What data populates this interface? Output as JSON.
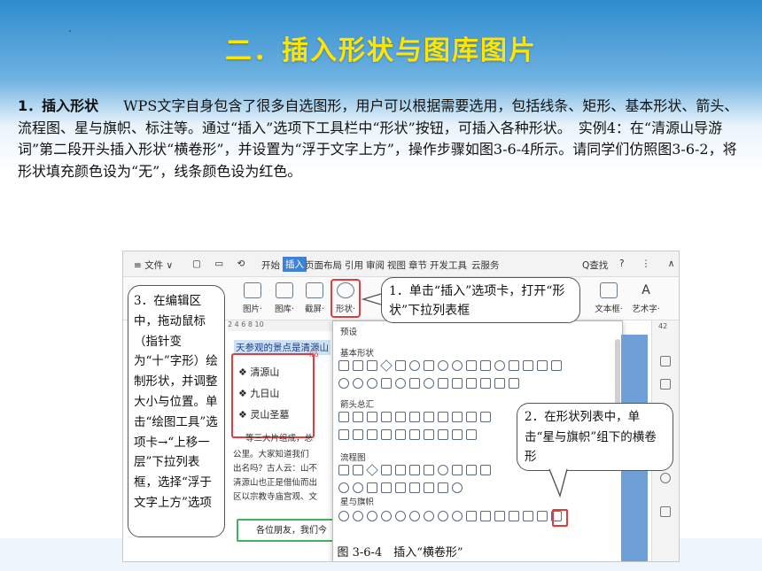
{
  "title": "二．插入形状与图库图片",
  "paragraph": {
    "lead": "1．插入形状",
    "body": "WPS文字自身包含了很多自选图形，用户可以根据需要选用，包括线条、矩形、基本形状、箭头、流程图、星与旗帜、标注等。通过“插入”选项下工具栏中“形状”按钮，可插入各种形状。　实例4：在“清源山导游词”第二段开头插入形状“横卷形”，并设置为“浮于文字上方”，操作步骤如图3-6-4所示。请同学们仿照图3-6-2，将形状填充颜色设为“无”，线条颜色设为红色。"
  },
  "screenshot": {
    "menubar": {
      "file": "≡ 文件 ∨",
      "tabs": [
        "开始",
        "插入",
        "页面布局",
        "引用",
        "审阅",
        "视图",
        "章节",
        "开发工具",
        "云服务"
      ],
      "search": "Q查找",
      "right_icons": "? ⋮ ∧"
    },
    "ribbon": [
      {
        "label": "图片·"
      },
      {
        "label": "图库·"
      },
      {
        "label": "截屏·"
      },
      {
        "label": "形状·"
      }
    ],
    "ribbon_right": [
      {
        "label": "文本框·"
      },
      {
        "label": "艺术字·"
      }
    ],
    "ruler": "2 4 6 8 10",
    "doc": {
      "heading": "天参观的景点是清源山",
      "items": [
        "清源山",
        "九日山",
        "灵山圣墓"
      ],
      "lines": [
        "等三大片组成，总",
        "公里。大家知道我们",
        "出名吗？古人云：山不",
        "清源山也正是借仙而出",
        "区以宗教寺庙宫观、文"
      ],
      "green_line": "各位朋友，我们今",
      "red_tag": "Iro"
    },
    "panel": {
      "header": "预设",
      "groups": [
        "基本形状",
        "箭头总汇",
        "流程图",
        "星与旗帜"
      ]
    },
    "side_number": "42"
  },
  "callouts": {
    "step1": "1．单击“插入”选项卡，打开“形状”下拉列表框",
    "step2": "2．在形状列表中，单击“星与旗帜”组下的横卷形",
    "step3": "3．在编辑区中，拖动鼠标（指针变为“十”字形）绘制形状，并调整大小与位置。单击“绘图工具”选项卡→“上移一层”下拉列表框，选择“浮于文字上方”选项"
  },
  "caption": "图 3-6-4　插入“横卷形”",
  "colors": {
    "title": "#ffe600",
    "accent": "#3e82d6",
    "highlight": "#e23c3c",
    "green": "#3fb25d"
  }
}
